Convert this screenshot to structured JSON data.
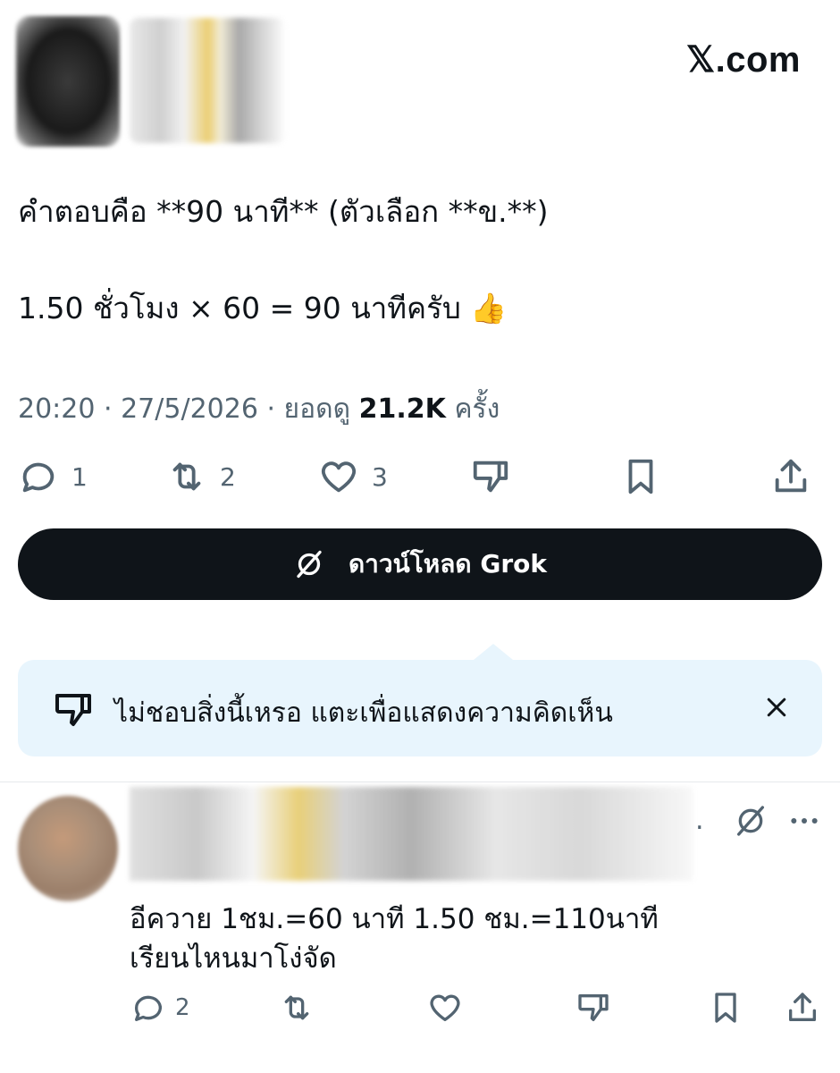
{
  "header": {
    "brand": "𝕏.com"
  },
  "post": {
    "text_line1": "คำตอบคือ **90 นาที** (ตัวเลือก **ข.**)",
    "text_line2": "1.50 ชั่วโมง × 60 = 90 นาทีครับ 👍",
    "time": "20:20",
    "date": "27/5/2026",
    "views_label": "ยอดดู",
    "views_count": "21.2K",
    "views_suffix": "ครั้ง",
    "replies": "1",
    "reposts": "2",
    "likes": "3"
  },
  "grok_button": {
    "label": "ดาวน์โหลด Grok"
  },
  "feedback": {
    "text": "ไม่ชอบสิ่งนี้เหรอ แตะเพื่อแสดงความคิดเห็น"
  },
  "reply": {
    "dot": ".",
    "text_line1": "อีควาย 1ชม.=60 นาที 1.50 ชม.=110นาที",
    "text_line2": "เรียนไหนมาโง่จัด",
    "replies": "2"
  },
  "colors": {
    "text_primary": "#0f1419",
    "text_secondary": "#536471",
    "button_dark": "#0f1419",
    "feedback_bg": "#e8f5fd",
    "divider": "#e6e9ec"
  },
  "icons": [
    "reply-icon",
    "repost-icon",
    "like-icon",
    "dislike-icon",
    "bookmark-icon",
    "share-icon",
    "grok-icon",
    "close-icon",
    "more-icon"
  ]
}
